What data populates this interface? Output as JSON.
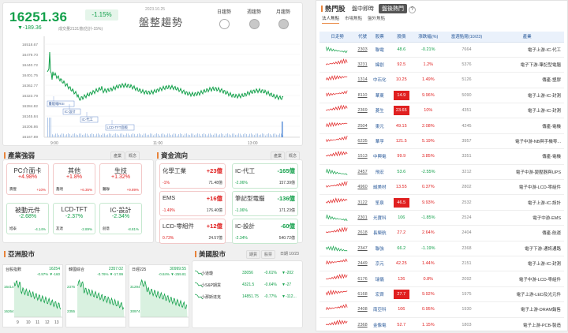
{
  "index": {
    "value": "16251.36",
    "pct": "-1.15%",
    "change": "▼-189.36",
    "volume": "成交量2131億(估計-15%)",
    "date": "2023.10.25",
    "title": "盤整趨勢",
    "trends": [
      {
        "label": "日趨勢",
        "on": false
      },
      {
        "label": "週趨勢",
        "on": true
      },
      {
        "label": "月趨勢",
        "on": true
      }
    ],
    "yticks": [
      "16518.67",
      "16479.70",
      "16440.72",
      "16401.75",
      "16362.77",
      "16323.79",
      "16284.82",
      "16245.84",
      "16206.86",
      "16167.89"
    ],
    "xticks": [
      "9:00",
      "11:00",
      "13:00"
    ],
    "annotations": [
      "量能縮RSI",
      "IC-設計",
      "IC-代工",
      "LCD-TFT面板"
    ]
  },
  "industry": {
    "title": "產業強弱",
    "tog": [
      "產業",
      "概念"
    ],
    "tiles": [
      {
        "name": "PC介面卡",
        "pct": "+4.98%",
        "a": "壽豐",
        "b": "+10%",
        "up": true
      },
      {
        "name": "其他",
        "pct": "+1.8%",
        "a": "鑫明",
        "b": "+6.35%",
        "up": true
      },
      {
        "name": "生技",
        "pct": "+1.32%",
        "a": "醫聯",
        "b": "+9.89%",
        "up": true
      },
      {
        "name": "被動元件",
        "pct": "-2.68%",
        "a": "旭泰",
        "b": "-4.14%",
        "up": false
      },
      {
        "name": "LCD-TFT",
        "pct": "-2.37%",
        "a": "友達",
        "b": "-2.89%",
        "up": false
      },
      {
        "name": "IC-設計",
        "pct": "-2.34%",
        "a": "創意",
        "b": "-8.81%",
        "up": false
      }
    ]
  },
  "capital": {
    "title": "資金流向",
    "tog": [
      "產業",
      "概念"
    ],
    "items": [
      {
        "name": "化學工業",
        "val": "+23億",
        "a": "-1%",
        "b": "71.48億",
        "up": true
      },
      {
        "name": "IC-代工",
        "val": "-165億",
        "a": "-2.06%",
        "b": "157.39億",
        "up": false
      },
      {
        "name": "EMS",
        "val": "+16億",
        "a": "-1.49%",
        "b": "176.40億",
        "up": true
      },
      {
        "name": "筆記型電腦",
        "val": "-136億",
        "a": "-1.06%",
        "b": "171.23億",
        "up": false
      },
      {
        "name": "LCD-零組件",
        "val": "+12億",
        "a": "0.73%",
        "b": "24.57億",
        "up": true
      },
      {
        "name": "IC-設計",
        "val": "-60億",
        "a": "-2.34%",
        "b": "540.72億",
        "up": false
      }
    ]
  },
  "asia": {
    "title": "亞洲股市",
    "items": [
      {
        "name": "台股指數",
        "val": "16254",
        "chg": "-0.97% ▼-160",
        "low": "16414",
        "high": "16264",
        "end": "16250"
      },
      {
        "name": "韓國綜合",
        "val": "2357.02",
        "chg": "-0.76% ▼-17.99",
        "low": "2376",
        "high": "2355"
      },
      {
        "name": "日經225",
        "val": "30999.55",
        "chg": "-0.84% ▼-259.81",
        "low": "31294",
        "high": "30974"
      }
    ],
    "xticks": [
      "9",
      "10",
      "11",
      "12",
      "13"
    ]
  },
  "us": {
    "title": "美國股市",
    "tog": [
      "期貨",
      "股票"
    ],
    "date": "日期 10/23",
    "items": [
      {
        "name": "小道瓊",
        "val": "33056",
        "pct": "-0.61%",
        "chg": "▼-202"
      },
      {
        "name": "小S&P期貨",
        "val": "4321.5",
        "pct": "-0.64%",
        "chg": "▼-27"
      },
      {
        "name": "小那斯達克",
        "val": "14851.75",
        "pct": "-0.77%",
        "chg": "▼-112..."
      }
    ]
  },
  "hot": {
    "title": "熱門股",
    "tabs": [
      "盤中即時",
      "盤後熱門"
    ],
    "subtabs": [
      "法人焦點",
      "市場焦點",
      "盤外焦點"
    ],
    "headers": [
      "日走勢",
      "代號",
      "股票",
      "股價",
      "漲跌幅(%)",
      "當週點閱(10/23)",
      "產業"
    ],
    "rows": [
      [
        "2303",
        "聯電",
        "48.6",
        "-0.21%",
        "7664",
        "電子上游-IC-代工",
        "n"
      ],
      [
        "3231",
        "緯創",
        "92.5",
        "1.2%",
        "5376",
        "電子下游-筆記型電腦",
        "u"
      ],
      [
        "1314",
        "中石化",
        "10.25",
        "1.49%",
        "5126",
        "傳產-塑膠",
        "u"
      ],
      [
        "8110",
        "華東",
        "14.9",
        "9.96%",
        "5090",
        "電子上游-IC-封測",
        "b"
      ],
      [
        "2369",
        "菱生",
        "23.65",
        "10%",
        "4351",
        "電子上游-IC-封測",
        "b"
      ],
      [
        "2504",
        "東元",
        "49.15",
        "2.08%",
        "4245",
        "傳產-電機",
        "u"
      ],
      [
        "6235",
        "華孚",
        "121.5",
        "5.19%",
        "3957",
        "電子中游-NB與手機零...",
        "u"
      ],
      [
        "1513",
        "中興電",
        "99.9",
        "3.85%",
        "3351",
        "傳產-電機",
        "u"
      ],
      [
        "2457",
        "飛宏",
        "53.6",
        "-2.55%",
        "3212",
        "電子中游-變壓器與UPS",
        "d"
      ],
      [
        "4960",
        "誠美材",
        "13.55",
        "0.37%",
        "2802",
        "電子中游-LCD-零組件",
        "u"
      ],
      [
        "3122",
        "笙泉",
        "46.5",
        "9.93%",
        "2532",
        "電子上游-IC-設計",
        "b"
      ],
      [
        "2301",
        "光寶科",
        "106",
        "-1.85%",
        "2524",
        "電子中游-EMS",
        "d"
      ],
      [
        "2618",
        "長榮航",
        "27.2",
        "2.64%",
        "2404",
        "傳產-航運",
        "u"
      ],
      [
        "2347",
        "聯強",
        "66.2",
        "-1.19%",
        "2368",
        "電子下游-通訊通路",
        "d"
      ],
      [
        "2449",
        "京元",
        "42.25",
        "1.44%",
        "2151",
        "電子上游-IC-封測",
        "u"
      ],
      [
        "6176",
        "瑞儀",
        "126",
        "0.8%",
        "2092",
        "電子中游-LCD-零組件",
        "u"
      ],
      [
        "6168",
        "宏齊",
        "27.7",
        "9.92%",
        "1975",
        "電子上游-LED及光元件",
        "b"
      ],
      [
        "2408",
        "南亞科",
        "106",
        "0.95%",
        "1930",
        "電子上游-DRAM銷售",
        "u"
      ],
      [
        "2368",
        "金像電",
        "52.7",
        "1.15%",
        "1803",
        "電子上游-PCB-製造",
        "u"
      ]
    ]
  },
  "colors": {
    "up": "#e02020",
    "down": "#12a04a"
  }
}
